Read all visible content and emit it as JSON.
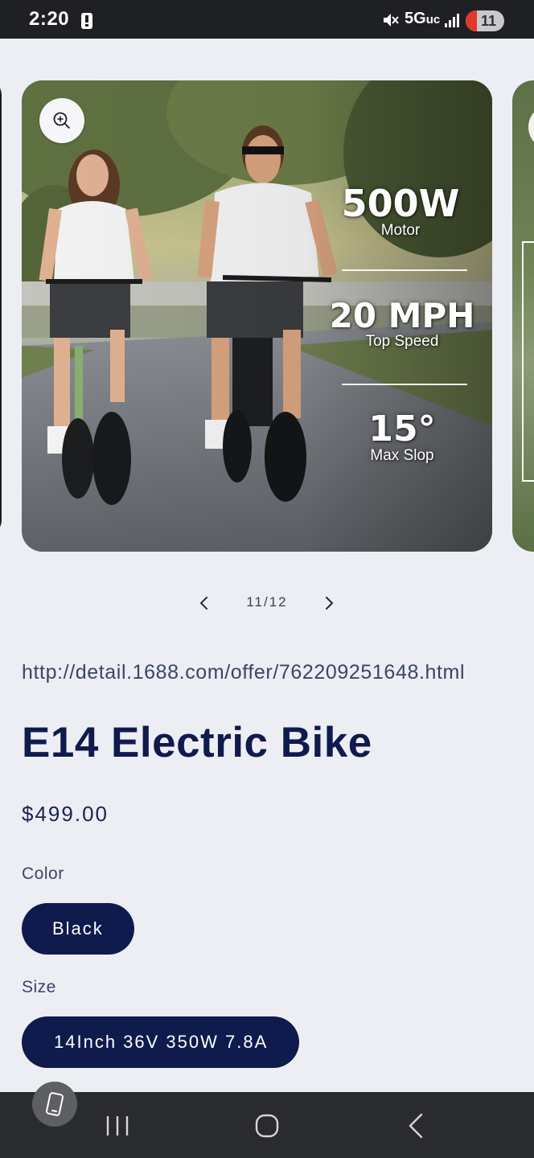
{
  "status_bar": {
    "time": "2:20",
    "network": "5G",
    "network_suffix": "uc",
    "battery": "11",
    "battery_color": "#e03a2b"
  },
  "gallery": {
    "position": "11/12",
    "zoom_icon": "zoom-in-icon",
    "prev_icon": "chevron-left-icon",
    "next_icon": "chevron-right-icon",
    "specs": [
      {
        "value": "500W",
        "label": "Motor"
      },
      {
        "value": "20 MPH",
        "label": "Top Speed"
      },
      {
        "value": "15°",
        "label": "Max Slop"
      }
    ]
  },
  "product": {
    "url": "http://detail.1688.com/offer/762209251648.html",
    "title": "E14 Electric Bike",
    "price": "$499.00",
    "color_label": "Color",
    "color_value": "Black",
    "size_label": "Size",
    "size_value": "14Inch 36V 350W 7.8A",
    "accent_color": "#0f1b4c"
  },
  "nav_bar": {
    "recent_icon": "recent-apps-icon",
    "home_icon": "home-icon",
    "back_icon": "back-icon"
  }
}
